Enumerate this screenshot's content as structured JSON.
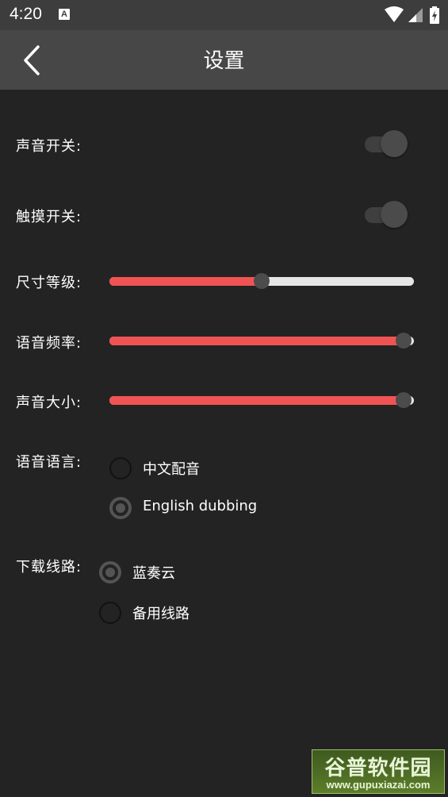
{
  "status_bar": {
    "time": "4:20",
    "notification_icon_letter": "A",
    "icons": [
      "wifi-icon",
      "signal-icon",
      "battery-charging-icon"
    ]
  },
  "app_bar": {
    "title": "设置",
    "back_icon": "chevron-left-icon"
  },
  "settings": {
    "sound_switch": {
      "label": "声音开关:",
      "on": false
    },
    "touch_switch": {
      "label": "触摸开关:",
      "on": false
    },
    "size_level": {
      "label": "尺寸等级:",
      "value": 0.5
    },
    "voice_rate": {
      "label": "语音频率:",
      "value": 0.965
    },
    "volume": {
      "label": "声音大小:",
      "value": 0.965
    },
    "voice_language": {
      "label": "语音语言:",
      "options": [
        {
          "label": "中文配音",
          "selected": false
        },
        {
          "label": "English dubbing",
          "selected": true
        }
      ]
    },
    "download_route": {
      "label": "下载线路:",
      "options": [
        {
          "label": "蓝奏云",
          "selected": true
        },
        {
          "label": "备用线路",
          "selected": false
        }
      ]
    }
  },
  "watermark": {
    "title": "谷普软件园",
    "url": "www.gupuxiazai.com"
  },
  "colors": {
    "background": "#232323",
    "app_bar": "#474747",
    "status_bar": "#3d3d3d",
    "slider_fill": "#f05353",
    "slider_rail": "#e6e6e6"
  }
}
